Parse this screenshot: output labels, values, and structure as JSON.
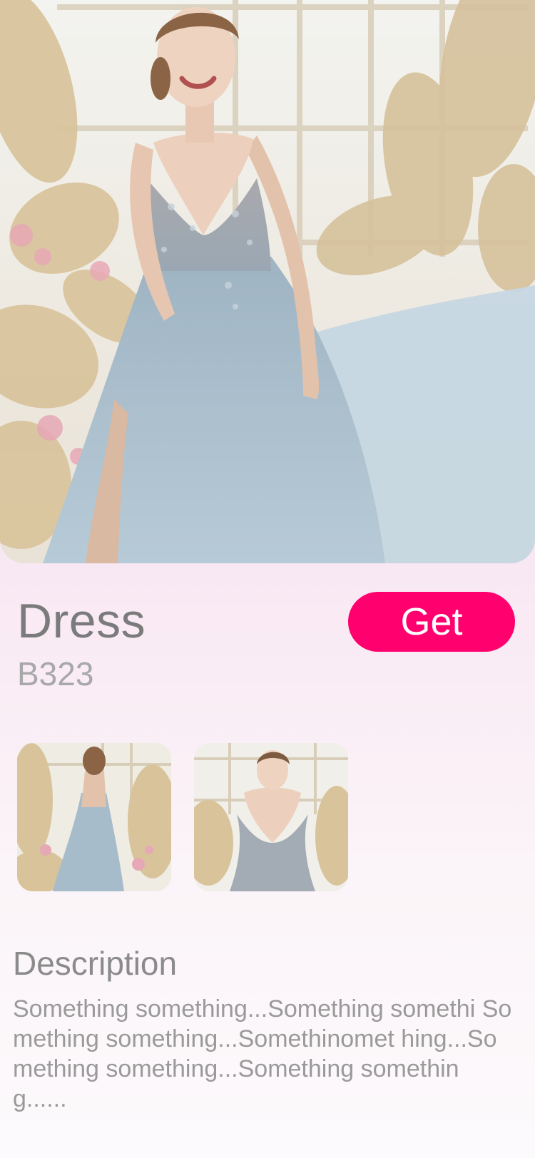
{
  "product": {
    "title": "Dress",
    "code": "B323",
    "get_label": "Get"
  },
  "images": {
    "hero": "dress-hero-photo",
    "thumbnails": [
      {
        "name": "dress-back-view-photo"
      },
      {
        "name": "dress-front-view-photo"
      }
    ]
  },
  "description": {
    "heading": "Description",
    "body": "Something something...Something somethi Something something...Somethinomet hing...Something something...Something something......"
  },
  "colors": {
    "accent": "#ff006e",
    "background_top": "#f8d3ee",
    "background_bottom": "#fcfafc",
    "text_primary": "#7b7b7b",
    "text_secondary": "#a8a8a8"
  }
}
